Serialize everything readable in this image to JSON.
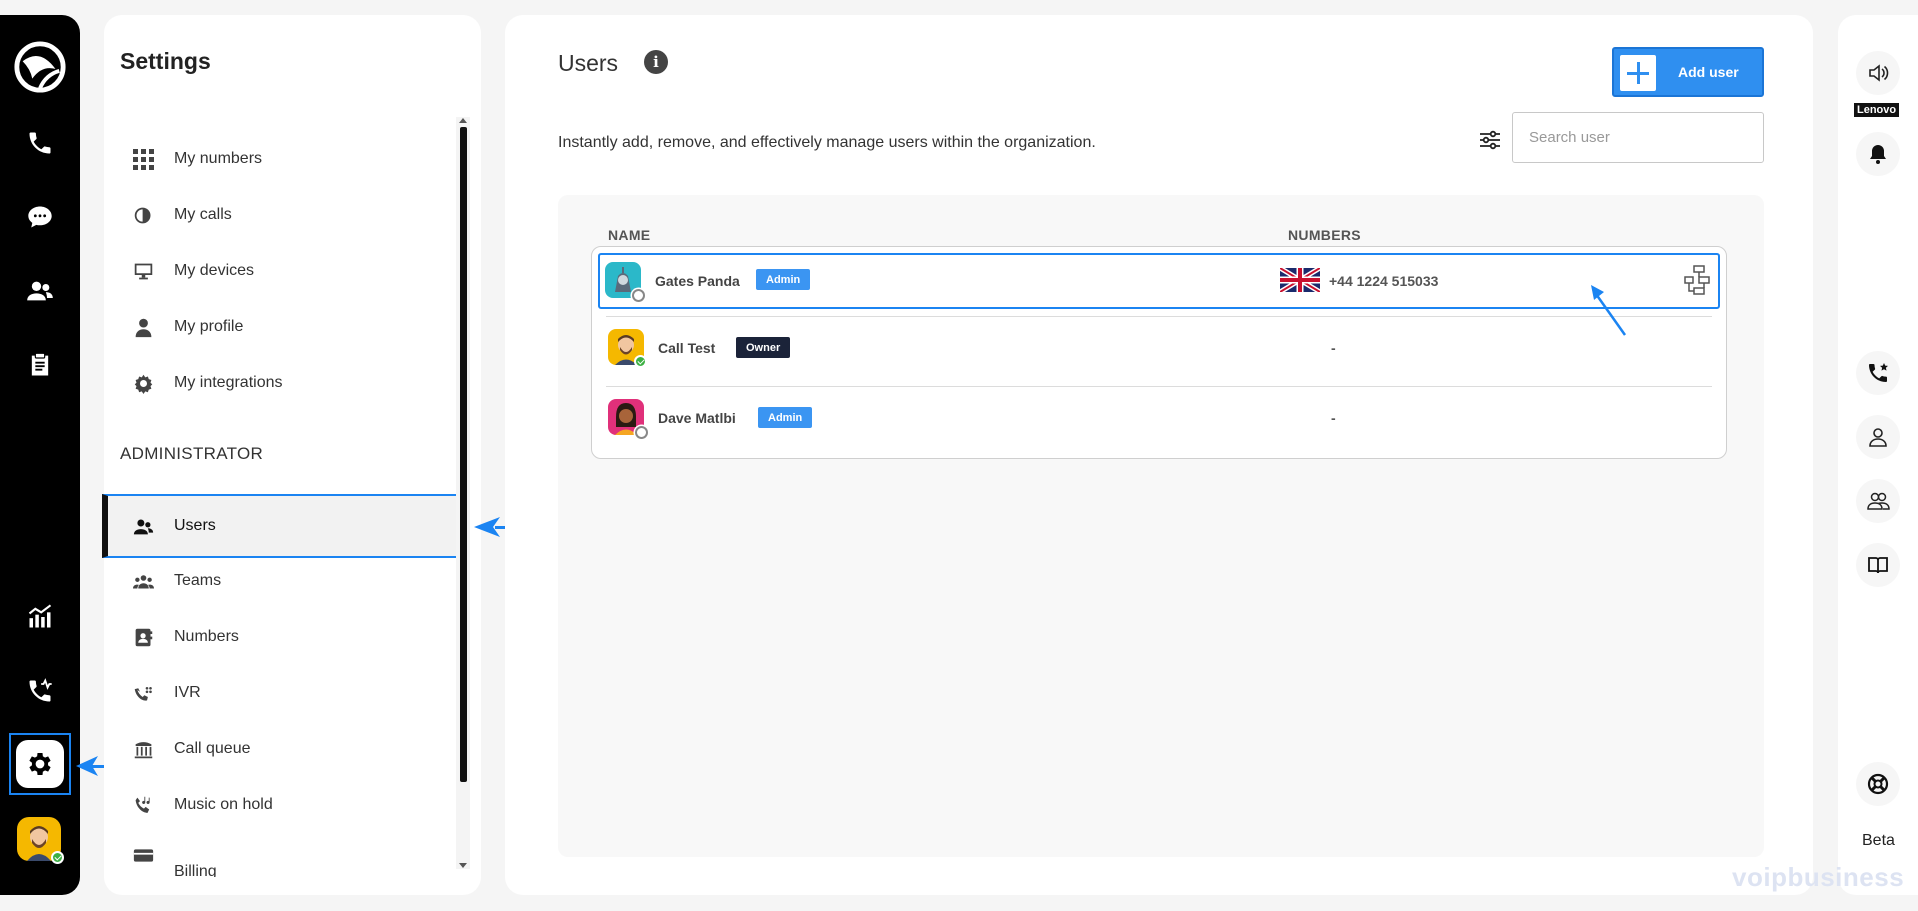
{
  "rail": {
    "items": [
      "phone-icon",
      "chat-icon",
      "contacts-icon",
      "notes-icon",
      "analytics-icon",
      "call-activity-icon",
      "gear-icon"
    ]
  },
  "settings": {
    "title": "Settings",
    "personal_items": [
      {
        "label": "My numbers",
        "icon": "grid-icon"
      },
      {
        "label": "My calls",
        "icon": "call-log-icon"
      },
      {
        "label": "My devices",
        "icon": "monitor-icon"
      },
      {
        "label": "My profile",
        "icon": "person-icon"
      },
      {
        "label": "My integrations",
        "icon": "integrations-icon"
      }
    ],
    "admin_heading": "ADMINISTRATOR",
    "admin_items": [
      {
        "label": "Users",
        "icon": "users-icon",
        "active": true
      },
      {
        "label": "Teams",
        "icon": "teams-icon"
      },
      {
        "label": "Numbers",
        "icon": "contact-book-icon"
      },
      {
        "label": "IVR",
        "icon": "ivr-icon"
      },
      {
        "label": "Call queue",
        "icon": "queue-icon"
      },
      {
        "label": "Music on hold",
        "icon": "music-hold-icon"
      },
      {
        "label": "Billing",
        "icon": "card-icon"
      }
    ]
  },
  "main": {
    "title": "Users",
    "subtitle": "Instantly add, remove, and effectively manage users within the organization.",
    "add_user_label": "Add user",
    "search_placeholder": "Search user",
    "columns": {
      "name": "NAME",
      "numbers": "NUMBERS"
    },
    "users": [
      {
        "name": "Gates Panda",
        "role": "Admin",
        "number": "+44 1224 515033",
        "status": "offline",
        "avatar_color": "#2bb8c9"
      },
      {
        "name": "Call Test",
        "role": "Owner",
        "number": "-",
        "status": "online",
        "avatar_color": "#f5b800"
      },
      {
        "name": "Dave Matlbi",
        "role": "Admin",
        "number": "-",
        "status": "offline",
        "avatar_color": "#e0307a"
      }
    ]
  },
  "right_rail": {
    "device_label": "Lenovo",
    "beta_label": "Beta"
  },
  "watermark": "voipbusiness",
  "colors": {
    "accent": "#1b84f2",
    "rail": "#000000",
    "admin_badge": "#3b95f2",
    "owner_badge": "#1b2339"
  }
}
